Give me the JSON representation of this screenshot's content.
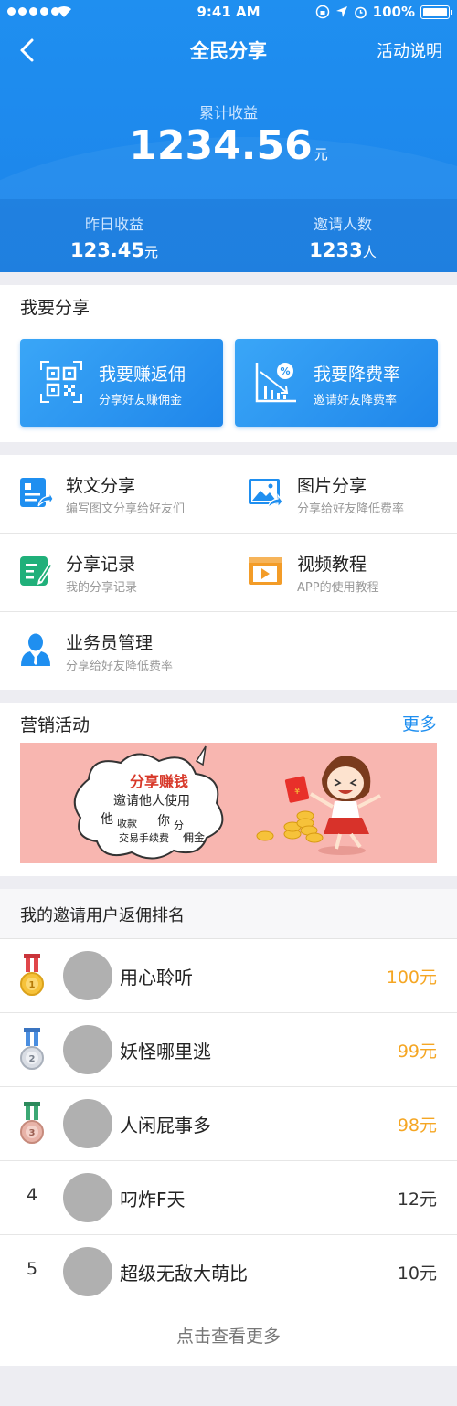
{
  "status_bar": {
    "time": "9:41 AM",
    "battery": "100%"
  },
  "nav": {
    "title": "全民分享",
    "action": "活动说明"
  },
  "earnings": {
    "total_label": "累计收益",
    "total_value": "1234.56",
    "total_unit": "元",
    "yesterday_label": "昨日收益",
    "yesterday_value": "123.45",
    "yesterday_unit": "元",
    "invite_label": "邀请人数",
    "invite_value": "1233",
    "invite_unit": "人"
  },
  "share": {
    "title": "我要分享",
    "buttons": [
      {
        "title": "我要赚返佣",
        "subtitle": "分享好友赚佣金",
        "icon": "qr-code-icon"
      },
      {
        "title": "我要降费率",
        "subtitle": "邀请好友降费率",
        "icon": "rate-down-chart-icon"
      }
    ]
  },
  "menu": [
    {
      "title": "软文分享",
      "subtitle": "编写图文分享给好友们",
      "icon": "article-share-icon",
      "color": "#1f8ff0"
    },
    {
      "title": "图片分享",
      "subtitle": "分享给好友降低费率",
      "icon": "image-share-icon",
      "color": "#1f8ff0"
    },
    {
      "title": "分享记录",
      "subtitle": "我的分享记录",
      "icon": "edit-record-icon",
      "color": "#20b07a"
    },
    {
      "title": "视频教程",
      "subtitle": "APP的使用教程",
      "icon": "video-icon",
      "color": "#f39c28"
    },
    {
      "title": "业务员管理",
      "subtitle": "分享给好友降低费率",
      "icon": "person-icon",
      "color": "#1f8ff0"
    }
  ],
  "marketing": {
    "title": "营销活动",
    "more": "更多",
    "banner": {
      "headline": "分享赚钱",
      "line1": "邀请他人使用",
      "line2a": "他",
      "line2b": "收款",
      "line2c": "你",
      "line2d": "分",
      "line3a": "交易手续费",
      "line3b": "佣金",
      "envelope_symbol": "¥"
    }
  },
  "ranking": {
    "title": "我的邀请用户返佣排名",
    "rows": [
      {
        "rank": "1",
        "name": "用心聆听",
        "amount": "100元"
      },
      {
        "rank": "2",
        "name": "妖怪哪里逃",
        "amount": "99元"
      },
      {
        "rank": "3",
        "name": "人闲屁事多",
        "amount": "98元"
      },
      {
        "rank": "4",
        "name": "叼炸F天",
        "amount": "12元"
      },
      {
        "rank": "5",
        "name": "超级无敌大萌比",
        "amount": "10元"
      }
    ],
    "see_more": "点击查看更多"
  }
}
